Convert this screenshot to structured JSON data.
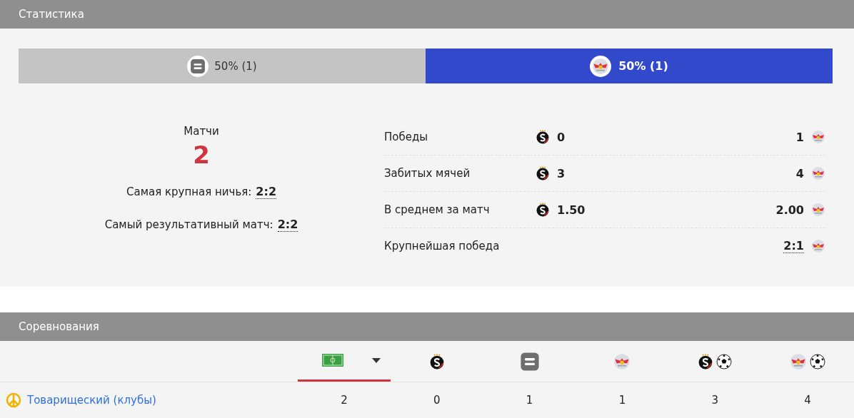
{
  "statistics": {
    "title": "Статистика",
    "split": [
      {
        "kind": "draw",
        "text": "50% (1)"
      },
      {
        "kind": "away",
        "text": "50% (1)"
      }
    ],
    "matches_label": "Матчи",
    "matches_value": "2",
    "records": [
      {
        "label": "Самая крупная ничья:",
        "value": "2:2"
      },
      {
        "label": "Самый результативный матч:",
        "value": "2:2"
      }
    ],
    "rows": [
      {
        "label": "Победы",
        "home": "0",
        "away": "1",
        "away_linked": false
      },
      {
        "label": "Забитых мячей",
        "home": "3",
        "away": "4",
        "away_linked": false
      },
      {
        "label": "В среднем за матч",
        "home": "1.50",
        "away": "2.00",
        "away_linked": false
      },
      {
        "label": "Крупнейшая победа",
        "away": "2:1",
        "away_linked": true
      }
    ]
  },
  "competitions": {
    "title": "Соревнования",
    "columns": [
      {
        "kind": "pitch",
        "selected": true
      },
      {
        "kind": "home",
        "selected": false
      },
      {
        "kind": "draw",
        "selected": false
      },
      {
        "kind": "away",
        "selected": false
      },
      {
        "kind": "home_goals",
        "selected": false
      },
      {
        "kind": "away_goals",
        "selected": false
      }
    ],
    "rows": [
      {
        "name": "Товарищеский (клубы)",
        "values": [
          "2",
          "0",
          "1",
          "1",
          "3",
          "4"
        ]
      }
    ]
  }
}
